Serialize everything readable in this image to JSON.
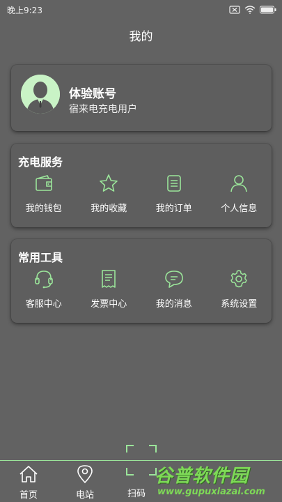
{
  "status_bar": {
    "time": "晚上9:23"
  },
  "header": {
    "title": "我的"
  },
  "account": {
    "name": "体验账号",
    "subtitle": "宿来电充电用户"
  },
  "service": {
    "title": "充电服务",
    "items": [
      {
        "label": "我的钱包",
        "icon": "wallet-icon"
      },
      {
        "label": "我的收藏",
        "icon": "star-icon"
      },
      {
        "label": "我的订单",
        "icon": "order-icon"
      },
      {
        "label": "个人信息",
        "icon": "person-icon"
      }
    ]
  },
  "tools": {
    "title": "常用工具",
    "items": [
      {
        "label": "客服中心",
        "icon": "headset-icon"
      },
      {
        "label": "发票中心",
        "icon": "invoice-icon"
      },
      {
        "label": "我的消息",
        "icon": "message-icon"
      },
      {
        "label": "系统设置",
        "icon": "gear-icon"
      }
    ]
  },
  "tab_bar": {
    "tabs": [
      {
        "label": "首页",
        "icon": "home-icon"
      },
      {
        "label": "电站",
        "icon": "location-icon"
      },
      {
        "label": "扫码",
        "icon": "scan-icon"
      }
    ]
  },
  "watermark": {
    "text": "谷普软件园",
    "url": "www.gupuxiazai.com"
  },
  "colors": {
    "background": "#626262",
    "accent": "#9be59a",
    "avatar_bg": "#c9f3c6"
  }
}
